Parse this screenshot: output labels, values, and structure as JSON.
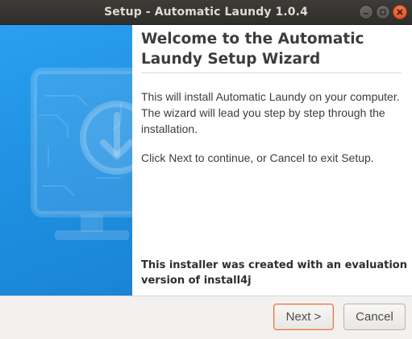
{
  "window": {
    "title": "Setup - Automatic Laundy 1.0.4"
  },
  "colors": {
    "banner": "#1f8fe0",
    "titlebar": "#353430",
    "close_button": "#e9602f",
    "default_button_border": "#e8733f"
  },
  "banner": {
    "icon": "monitor-download-icon"
  },
  "content": {
    "heading": "Welcome to the Automatic Laundy Setup Wizard",
    "paragraph1": "This will install Automatic Laundy on your computer. The wizard will lead you step by step through the installation.",
    "paragraph2": "Click Next to continue, or Cancel to exit Setup.",
    "footer_note": "This installer was created with an evaluation version of install4j"
  },
  "buttons": {
    "next": "Next >",
    "cancel": "Cancel"
  }
}
